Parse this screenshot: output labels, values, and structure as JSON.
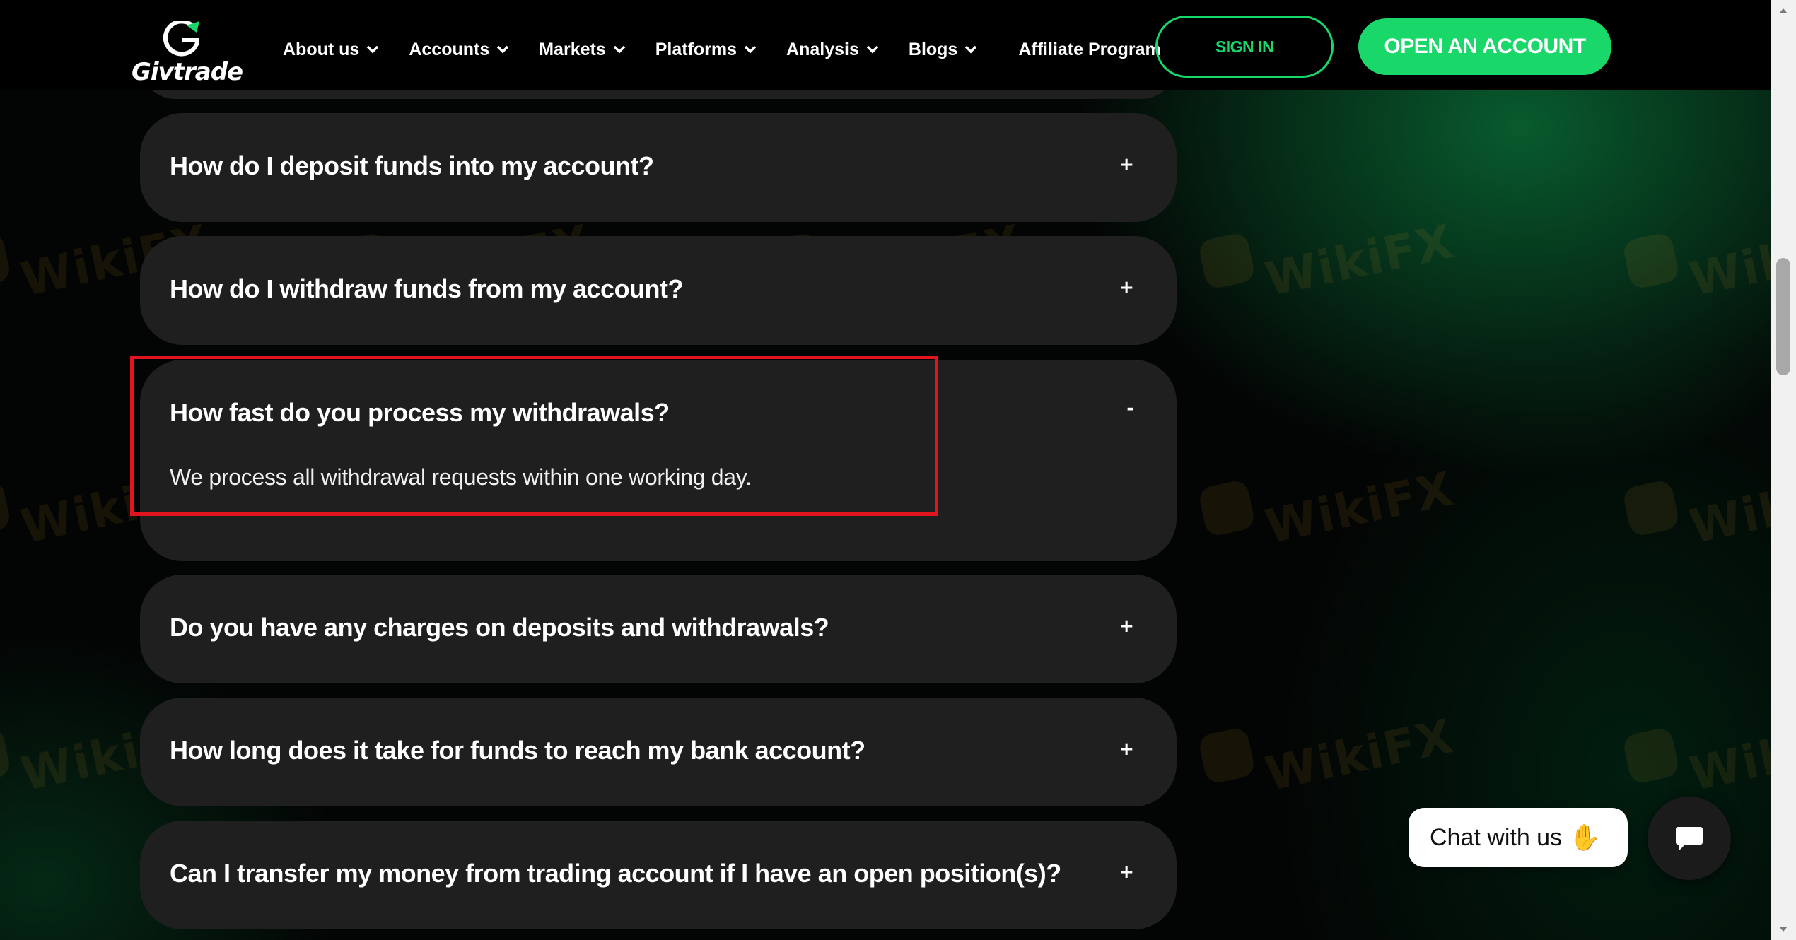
{
  "brand": {
    "name": "Givtrade",
    "icon": "g-logo-icon",
    "accent": "#19d769"
  },
  "nav": {
    "items": [
      {
        "label": "About us",
        "has_dropdown": true
      },
      {
        "label": "Accounts",
        "has_dropdown": true
      },
      {
        "label": "Markets",
        "has_dropdown": true
      },
      {
        "label": "Platforms",
        "has_dropdown": true
      },
      {
        "label": "Analysis",
        "has_dropdown": true
      },
      {
        "label": "Blogs",
        "has_dropdown": true
      },
      {
        "label": "Affiliate Program",
        "has_dropdown": false
      }
    ],
    "sign_in": "SIGN IN",
    "open_account": "OPEN AN ACCOUNT"
  },
  "faq": {
    "items": [
      {
        "question": "How do I deposit funds into my account?",
        "toggle": "+",
        "expanded": false
      },
      {
        "question": "How do I withdraw funds from my account?",
        "toggle": "+",
        "expanded": false
      },
      {
        "question": "How fast do you process my withdrawals?",
        "toggle": "-",
        "expanded": true,
        "answer": "We process all withdrawal requests within one working day."
      },
      {
        "question": "Do you have any charges on deposits and withdrawals?",
        "toggle": "+",
        "expanded": false
      },
      {
        "question": "How long does it take for funds to reach my bank account?",
        "toggle": "+",
        "expanded": false
      },
      {
        "question": "Can I transfer my money from trading account if I have an open position(s)?",
        "toggle": "+",
        "expanded": false
      }
    ]
  },
  "chat": {
    "label": "Chat with us",
    "wave_icon": "waving-hand-icon",
    "button_icon": "chat-icon"
  },
  "watermark": {
    "text": "WikiFX"
  },
  "colors": {
    "highlight": "#e0151f",
    "card": "#1f1f1f"
  }
}
